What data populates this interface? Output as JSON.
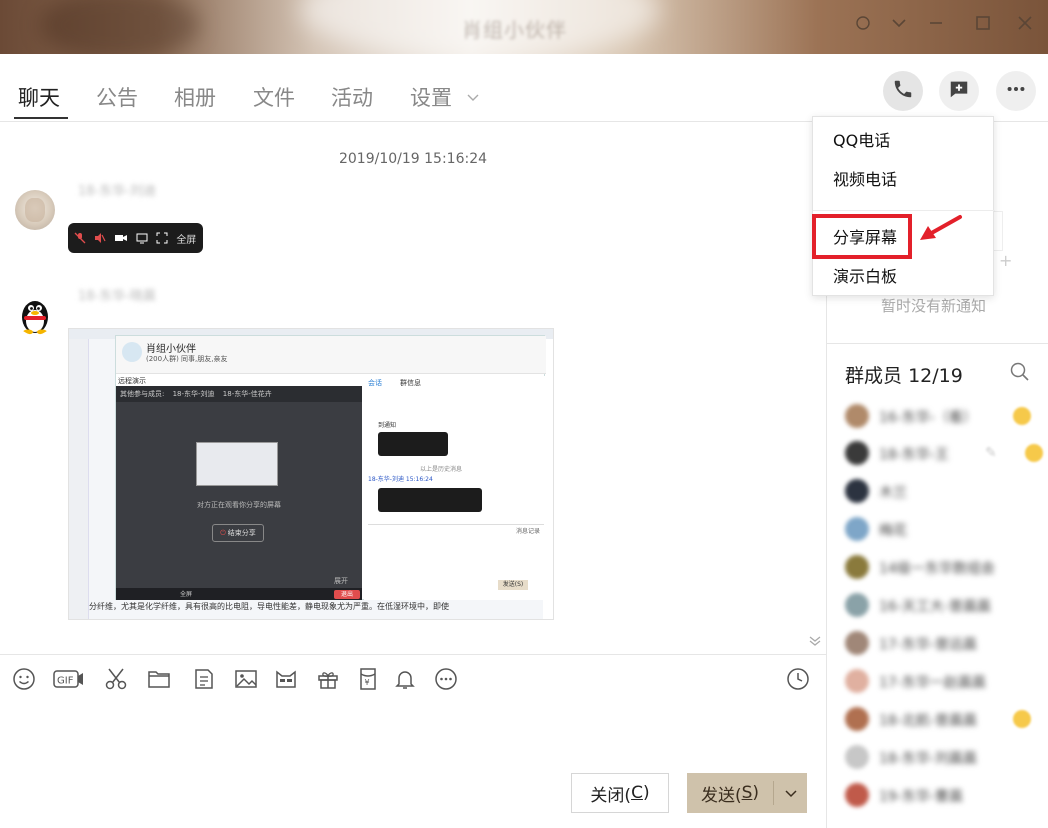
{
  "window": {
    "title": "肖组小伙伴"
  },
  "tabs": [
    {
      "label": "聊天",
      "active": true
    },
    {
      "label": "公告",
      "active": false
    },
    {
      "label": "相册",
      "active": false
    },
    {
      "label": "文件",
      "active": false
    },
    {
      "label": "活动",
      "active": false
    },
    {
      "label": "设置",
      "active": false,
      "has_dropdown": true
    }
  ],
  "top_actions": [
    {
      "icon": "phone-icon",
      "active": true
    },
    {
      "icon": "add-chat-icon",
      "active": false
    },
    {
      "icon": "more-icon",
      "active": false
    }
  ],
  "chat": {
    "timestamp": "2019/10/19 15:16:24",
    "messages": [
      {
        "sender": "18-东华-刘迪",
        "call_bar": {
          "fullscreen_label": "全屏"
        }
      },
      {
        "sender": "18-东华-晓晨",
        "screenshot": {
          "group_title": "肖组小伙伴",
          "group_subtitle": "(200人群) 同事,朋友,亲友",
          "remote_label": "远程演示",
          "participants_label": "其他参与成员:",
          "p1": "18-东华-刘迪",
          "p2": "18-东华-佳花卉",
          "sharing_text": "对方正在观看你分享的屏幕",
          "end_share": "结束分享",
          "expand": "展开",
          "fullscreen": "全屏",
          "exit": "退出",
          "tab_chat": "会话",
          "tab_group": "群信息",
          "notice_short": "到通知",
          "history": "以上是历史消息",
          "msg_name": "18-东华-刘迪  15:16:24",
          "record": "消息记录",
          "send": "发送(S)",
          "doc_text": "分纤维，尤其是化学纤维，具有很高的比电阻，导电性能差，静电现象尤为严重。在低湿环境中，即使"
        }
      }
    ]
  },
  "toolbar": {
    "icons": [
      "emoji-icon",
      "gif-icon",
      "scissors-icon",
      "folder-icon",
      "doc-icon",
      "image-icon",
      "cat-icon",
      "gift-icon",
      "red-packet-icon",
      "bell-icon",
      "more-circle-icon",
      "history-clock-icon"
    ]
  },
  "footer": {
    "close_label": "关闭(",
    "close_key": "C",
    "close_tail": ")",
    "send_label": "发送(",
    "send_key": "S",
    "send_tail": ")"
  },
  "sidebar": {
    "notice_empty": "暂时没有新通知",
    "members_label": "群成员",
    "members_count": "12/19",
    "members": [
      {
        "name": "16-东华-（看）",
        "badge": true
      },
      {
        "name": "18-东华-王",
        "badge": true,
        "pen": true
      },
      {
        "name": "木兰",
        "badge": false
      },
      {
        "name": "梅花",
        "badge": false
      },
      {
        "name": "14级一东华数组会",
        "badge": false
      },
      {
        "name": "16-天工大-曾晨晨",
        "badge": false
      },
      {
        "name": "17-东华-曾远晨",
        "badge": false
      },
      {
        "name": "17-东华一赵晨晨",
        "badge": false
      },
      {
        "name": "18-北航-曾晨晨",
        "badge": true
      },
      {
        "name": "18-东华-刘晨晨",
        "badge": false
      },
      {
        "name": "19-东华-曹晨",
        "badge": false
      }
    ]
  },
  "dropdown": {
    "items": [
      {
        "label": "QQ电话"
      },
      {
        "label": "视频电话"
      },
      {
        "label": "分享屏幕",
        "highlighted": true
      },
      {
        "label": "演示白板"
      }
    ]
  },
  "colors": {
    "accent": "#e3202a",
    "send_button": "#cfc2ab"
  }
}
